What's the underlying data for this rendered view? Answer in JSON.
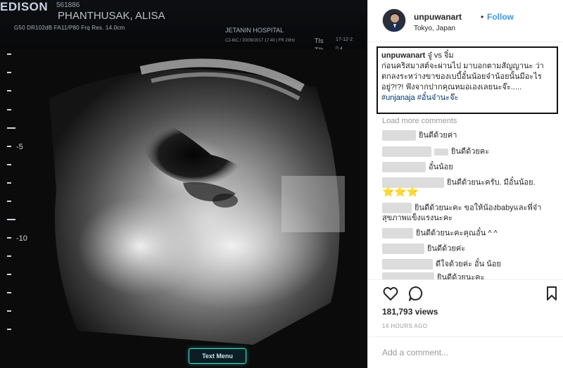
{
  "media": {
    "brand": "EDISON",
    "id_number": "561886",
    "patient_name": "PHANTHUSAK, ALISA",
    "params": "G50 DR102dB FA11/P80 Frq Res. 14.0cm",
    "hospital": "JETANIN HOSPITAL",
    "datetime": "C2-6IC / 20/09/2017 17:40 | FR 29Hz",
    "hud_right": [
      "TIs",
      "TIb"
    ],
    "hud_right_values": [
      "17-12-2",
      "0.4"
    ],
    "depth_labels": [
      "-5",
      "-10"
    ],
    "text_mode_label": "Text Menu"
  },
  "header": {
    "username": "unpuwanart",
    "separator": "•",
    "follow_label": "Follow",
    "location": "Tokyo, Japan"
  },
  "caption": {
    "username": "unpuwanart",
    "line1": "จู๋ vs จิ๋ม",
    "body": "ก่อนคริสมาสต์จะผ่านไป มาบอกตามสัญญานะ ว่าตกลงระหว่างขาของเบบี้อั๋นน้อยจ๋าน้อยนั้นมีอะไรอยู่?!?! ฟังจากปากคุณหมอเองเลยนะจ๊ะ.....",
    "hashtags": [
      "#unjanaja",
      "#อั๋นจ๋านะจ๊ะ"
    ]
  },
  "load_more": "Load more comments",
  "comments": [
    {
      "text": "ยินดีด้วยค่า"
    },
    {
      "text": "ยินดีด้วยคะ"
    },
    {
      "text": "อั๋นน้อย"
    },
    {
      "text": "ยินดีด้วยนะครับ. มีอั๋นน้อย."
    },
    {
      "text": "⭐⭐⭐"
    },
    {
      "text": "ยินดีด้วยนะคะ ขอให้น้องbabyและพี่จ๋าสุขภาพแข็งแรงนะคะ"
    },
    {
      "text": "ยินดีด้วยนะคะคุณอั๋น ^ ^"
    },
    {
      "text": "ยินดีด้วยค่ะ"
    },
    {
      "text": "ดีใจด้วยค่ะ อั๋น น้อย"
    },
    {
      "text": "ยินดีด้วยนะคะ"
    }
  ],
  "actions": {
    "like_icon": "heart-icon",
    "comment_icon": "comment-icon",
    "save_icon": "bookmark-icon"
  },
  "views": "181,793 views",
  "time_ago": "14 HOURS AGO",
  "add_comment_placeholder": "Add a comment..."
}
